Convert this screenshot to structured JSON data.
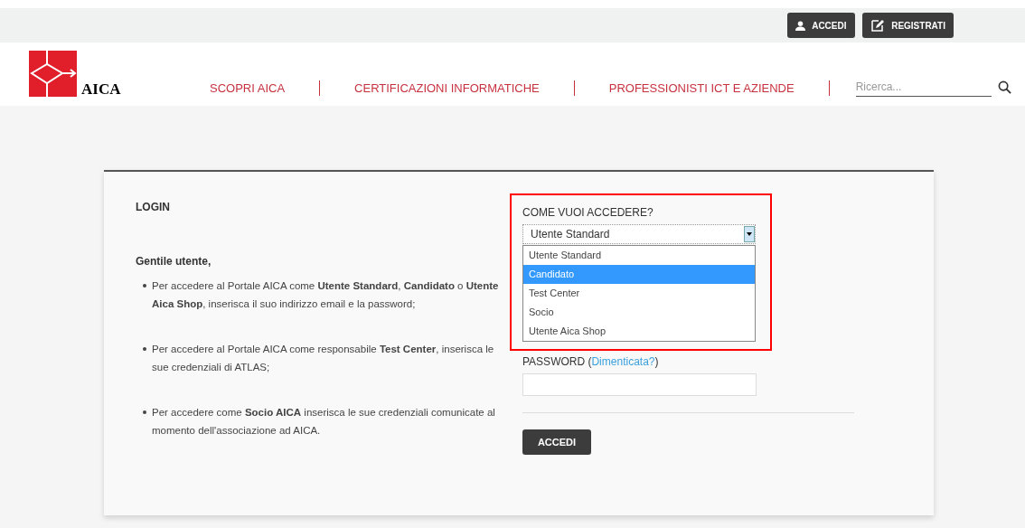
{
  "top_bar": {
    "buttons": [
      {
        "label": "ACCEDI",
        "kind": "user"
      },
      {
        "label": "REGISTRATI",
        "kind": "edit"
      }
    ]
  },
  "header": {
    "logo_text": "AICA",
    "nav": [
      "SCOPRI AICA",
      "CERTIFICAZIONI INFORMATICHE",
      "PROFESSIONISTI ICT E AZIENDE"
    ],
    "search": {
      "placeholder": "Ricerca..."
    }
  },
  "login": {
    "title": "LOGIN",
    "greeting": "Gentile utente,",
    "bullets": [
      "Per accedere al Portale AICA come **Utente Standard**, **Candidato** o **Utente Aica Shop**, inserisca il suo indirizzo email e la password;",
      "Per accedere al Portale AICA come responsabile **Test Center**, inserisca le sue credenziali di ATLAS;",
      "Per accedere come **Socio AICA** inserisca le sue credenziali comunicate al momento dell'associazione ad AICA."
    ],
    "access_label": "COME VUOI ACCEDERE?",
    "select_value": "Utente Standard",
    "options": [
      {
        "label": "Utente Standard",
        "selected": false
      },
      {
        "label": "Candidato",
        "selected": true
      },
      {
        "label": "Test Center",
        "selected": false
      },
      {
        "label": "Socio",
        "selected": false
      },
      {
        "label": "Utente Aica Shop",
        "selected": false
      }
    ],
    "password_label": "PASSWORD (",
    "forgot_link": "Dimenticata?",
    "password_label_end": ")",
    "submit": "ACCEDI"
  }
}
